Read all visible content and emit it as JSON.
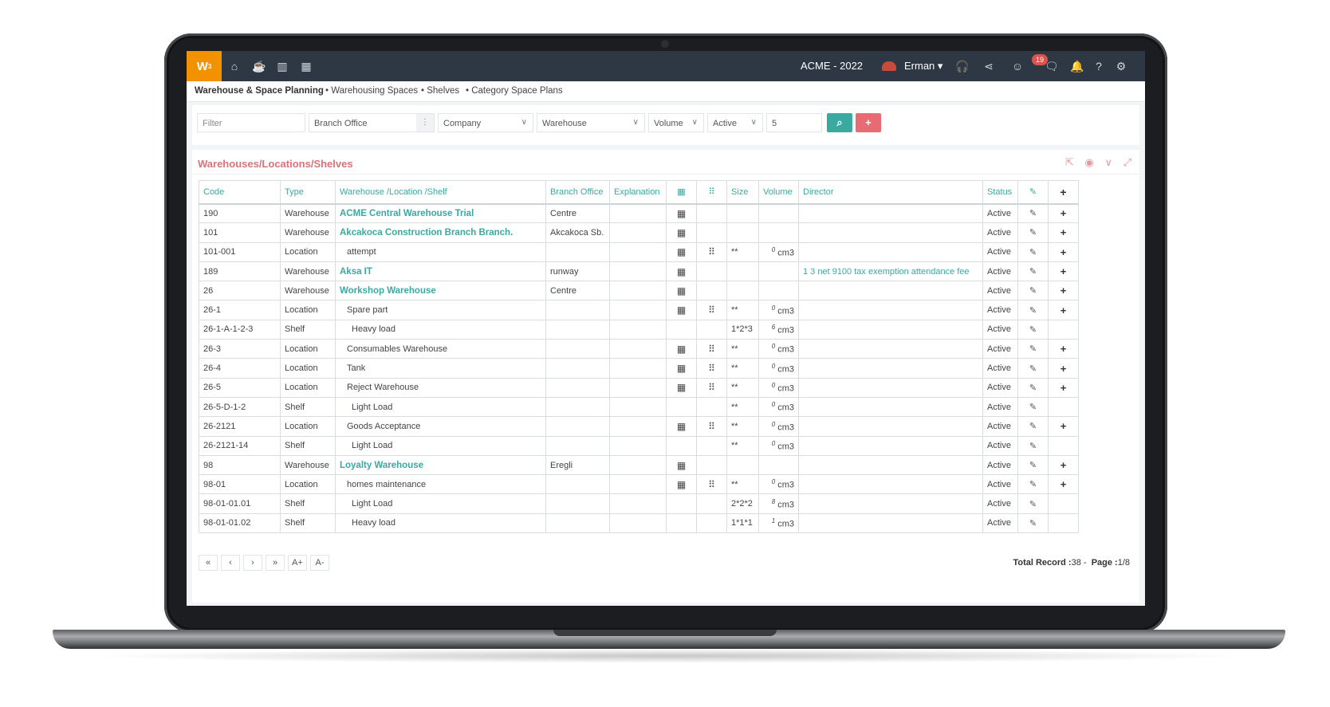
{
  "app": {
    "logo": "W",
    "logo_sup": "3",
    "company": "ACME - 2022",
    "user": "Erman",
    "notification_count": "19",
    "accent_color": "#3aaaa0",
    "brand_color": "#f39200"
  },
  "breadcrumb": [
    "Warehouse & Space Planning",
    "Warehousing Spaces",
    "Shelves",
    "Category Space Plans"
  ],
  "filters": {
    "filter_placeholder": "Filter",
    "branch_office": "Branch Office",
    "company": "Company",
    "warehouse": "Warehouse",
    "volume": "Volume",
    "status": "Active",
    "page_size": "5"
  },
  "panel": {
    "title": "Warehouses/Locations/Shelves"
  },
  "table": {
    "headers": [
      "Code",
      "Type",
      "Warehouse /Location /Shelf",
      "Branch Office",
      "Explanation",
      "",
      "",
      "Size",
      "Volume",
      "Director",
      "Status",
      "",
      ""
    ],
    "rows": [
      {
        "code": "190",
        "type": "Warehouse",
        "name": "ACME Central Warehouse Trial",
        "level": 0,
        "branch": "Centre",
        "g1": true,
        "g2": false,
        "size": "",
        "vol": "",
        "unit": "",
        "director": "",
        "status": "Active",
        "plus": true
      },
      {
        "code": "101",
        "type": "Warehouse",
        "name": "Akcakoca Construction Branch Branch.",
        "level": 0,
        "branch": "Akcakoca Sb.",
        "g1": true,
        "g2": false,
        "size": "",
        "vol": "",
        "unit": "",
        "director": "",
        "status": "Active",
        "plus": true
      },
      {
        "code": "101-001",
        "type": "Location",
        "name": "attempt",
        "level": 1,
        "branch": "",
        "g1": true,
        "g2": true,
        "size": "**",
        "vol": "0",
        "unit": "cm3",
        "director": "",
        "status": "Active",
        "plus": true
      },
      {
        "code": "189",
        "type": "Warehouse",
        "name": "Aksa IT",
        "level": 0,
        "branch": "runway",
        "g1": true,
        "g2": false,
        "size": "",
        "vol": "",
        "unit": "",
        "director": "1 3 net 9100 tax exemption attendance fee",
        "status": "Active",
        "plus": true
      },
      {
        "code": "26",
        "type": "Warehouse",
        "name": "Workshop Warehouse",
        "level": 0,
        "branch": "Centre",
        "g1": true,
        "g2": false,
        "size": "",
        "vol": "",
        "unit": "",
        "director": "",
        "status": "Active",
        "plus": true
      },
      {
        "code": "26-1",
        "type": "Location",
        "name": "Spare part",
        "level": 1,
        "branch": "",
        "g1": true,
        "g2": true,
        "size": "**",
        "vol": "0",
        "unit": "cm3",
        "director": "",
        "status": "Active",
        "plus": true
      },
      {
        "code": "26-1-A-1-2-3",
        "type": "Shelf",
        "name": "Heavy load",
        "level": 2,
        "branch": "",
        "g1": false,
        "g2": false,
        "size": "1*2*3",
        "vol": "6",
        "unit": "cm3",
        "director": "",
        "status": "Active",
        "plus": false
      },
      {
        "code": "26-3",
        "type": "Location",
        "name": "Consumables Warehouse",
        "level": 1,
        "branch": "",
        "g1": true,
        "g2": true,
        "size": "**",
        "vol": "0",
        "unit": "cm3",
        "director": "",
        "status": "Active",
        "plus": true
      },
      {
        "code": "26-4",
        "type": "Location",
        "name": "Tank",
        "level": 1,
        "branch": "",
        "g1": true,
        "g2": true,
        "size": "**",
        "vol": "0",
        "unit": "cm3",
        "director": "",
        "status": "Active",
        "plus": true
      },
      {
        "code": "26-5",
        "type": "Location",
        "name": "Reject Warehouse",
        "level": 1,
        "branch": "",
        "g1": true,
        "g2": true,
        "size": "**",
        "vol": "0",
        "unit": "cm3",
        "director": "",
        "status": "Active",
        "plus": true
      },
      {
        "code": "26-5-D-1-2",
        "type": "Shelf",
        "name": "Light Load",
        "level": 2,
        "branch": "",
        "g1": false,
        "g2": false,
        "size": "**",
        "vol": "0",
        "unit": "cm3",
        "director": "",
        "status": "Active",
        "plus": false
      },
      {
        "code": "26-2121",
        "type": "Location",
        "name": "Goods Acceptance",
        "level": 1,
        "branch": "",
        "g1": true,
        "g2": true,
        "size": "**",
        "vol": "0",
        "unit": "cm3",
        "director": "",
        "status": "Active",
        "plus": true
      },
      {
        "code": "26-2121-14",
        "type": "Shelf",
        "name": "Light Load",
        "level": 2,
        "branch": "",
        "g1": false,
        "g2": false,
        "size": "**",
        "vol": "0",
        "unit": "cm3",
        "director": "",
        "status": "Active",
        "plus": false
      },
      {
        "code": "98",
        "type": "Warehouse",
        "name": "Loyalty Warehouse",
        "level": 0,
        "branch": "Eregli",
        "g1": true,
        "g2": false,
        "size": "",
        "vol": "",
        "unit": "",
        "director": "",
        "status": "Active",
        "plus": true
      },
      {
        "code": "98-01",
        "type": "Location",
        "name": "homes maintenance",
        "level": 1,
        "branch": "",
        "g1": true,
        "g2": true,
        "size": "**",
        "vol": "0",
        "unit": "cm3",
        "director": "",
        "status": "Active",
        "plus": true
      },
      {
        "code": "98-01-01.01",
        "type": "Shelf",
        "name": "Light Load",
        "level": 2,
        "branch": "",
        "g1": false,
        "g2": false,
        "size": "2*2*2",
        "vol": "8",
        "unit": "cm3",
        "director": "",
        "status": "Active",
        "plus": false
      },
      {
        "code": "98-01-01.02",
        "type": "Shelf",
        "name": "Heavy load",
        "level": 2,
        "branch": "",
        "g1": false,
        "g2": false,
        "size": "1*1*1",
        "vol": "1",
        "unit": "cm3",
        "director": "",
        "status": "Active",
        "plus": false
      }
    ]
  },
  "pager": {
    "buttons": [
      "«",
      "‹",
      "›",
      "»",
      "A+",
      "A-"
    ],
    "total_label": "Total Record :",
    "total_value": "38",
    "page_label": "Page :",
    "page_value": "1/8"
  }
}
